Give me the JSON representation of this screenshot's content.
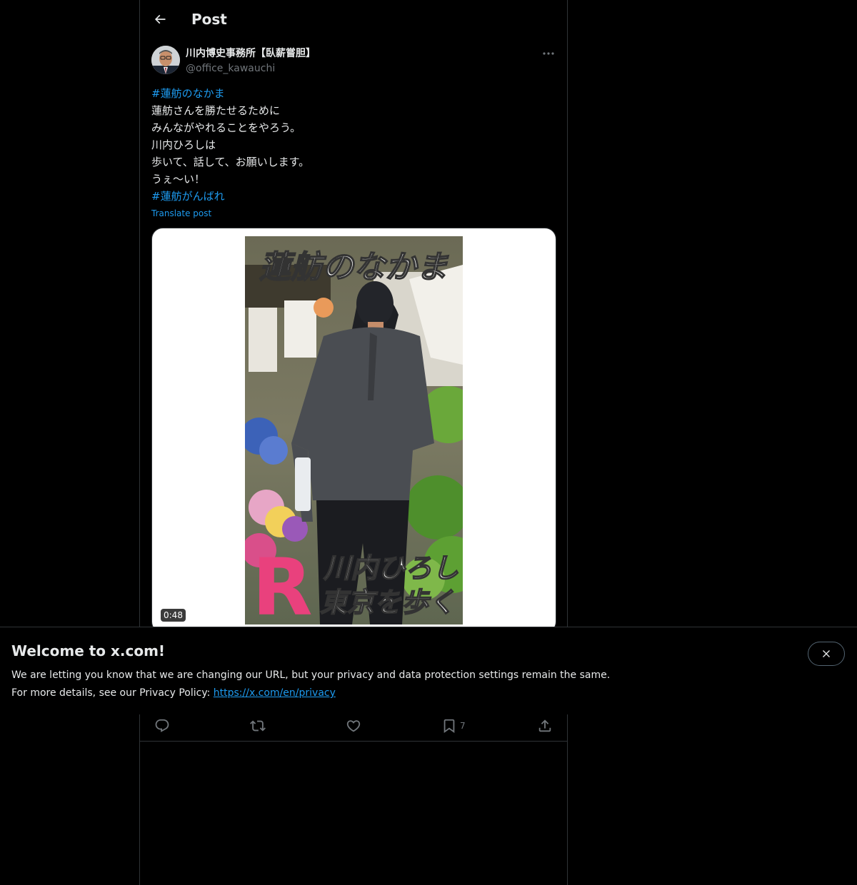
{
  "header": {
    "title": "Post"
  },
  "author": {
    "display_name": "川内博史事務所【臥薪嘗胆】",
    "handle": "@office_kawauchi"
  },
  "tweet": {
    "lines": [
      {
        "text": "#蓮舫のなかま",
        "type": "hashtag"
      },
      {
        "text": "蓮舫さんを勝たせるために",
        "type": "text"
      },
      {
        "text": "みんながやれることをやろう。",
        "type": "text"
      },
      {
        "text": "川内ひろしは",
        "type": "text"
      },
      {
        "text": "歩いて、話して、お願いします。",
        "type": "text"
      },
      {
        "text": "うぇ〜い！",
        "type": "text"
      },
      {
        "text": "#蓮舫がんばれ",
        "type": "hashtag"
      }
    ],
    "translate_label": "Translate post"
  },
  "media": {
    "duration": "0:48",
    "overlay_top": "蓮舫のなかま",
    "overlay_bottom_line1": "川内ひろし",
    "overlay_bottom_line2": "東京を歩く",
    "overlay_logo": "R"
  },
  "actions": {
    "reply_count": "",
    "repost_count": "",
    "like_count": "",
    "bookmark_count": "7",
    "share_count": ""
  },
  "banner": {
    "title": "Welcome to x.com!",
    "line1": "We are letting you know that we are changing our URL, but your privacy and data protection settings remain the same.",
    "line2_prefix": "For more details, see our Privacy Policy: ",
    "link_text": "https://x.com/en/privacy"
  },
  "colors": {
    "background": "#000000",
    "text": "#e7e9ea",
    "muted": "#71767b",
    "accent": "#1d9bf0",
    "border": "#2f3336"
  }
}
